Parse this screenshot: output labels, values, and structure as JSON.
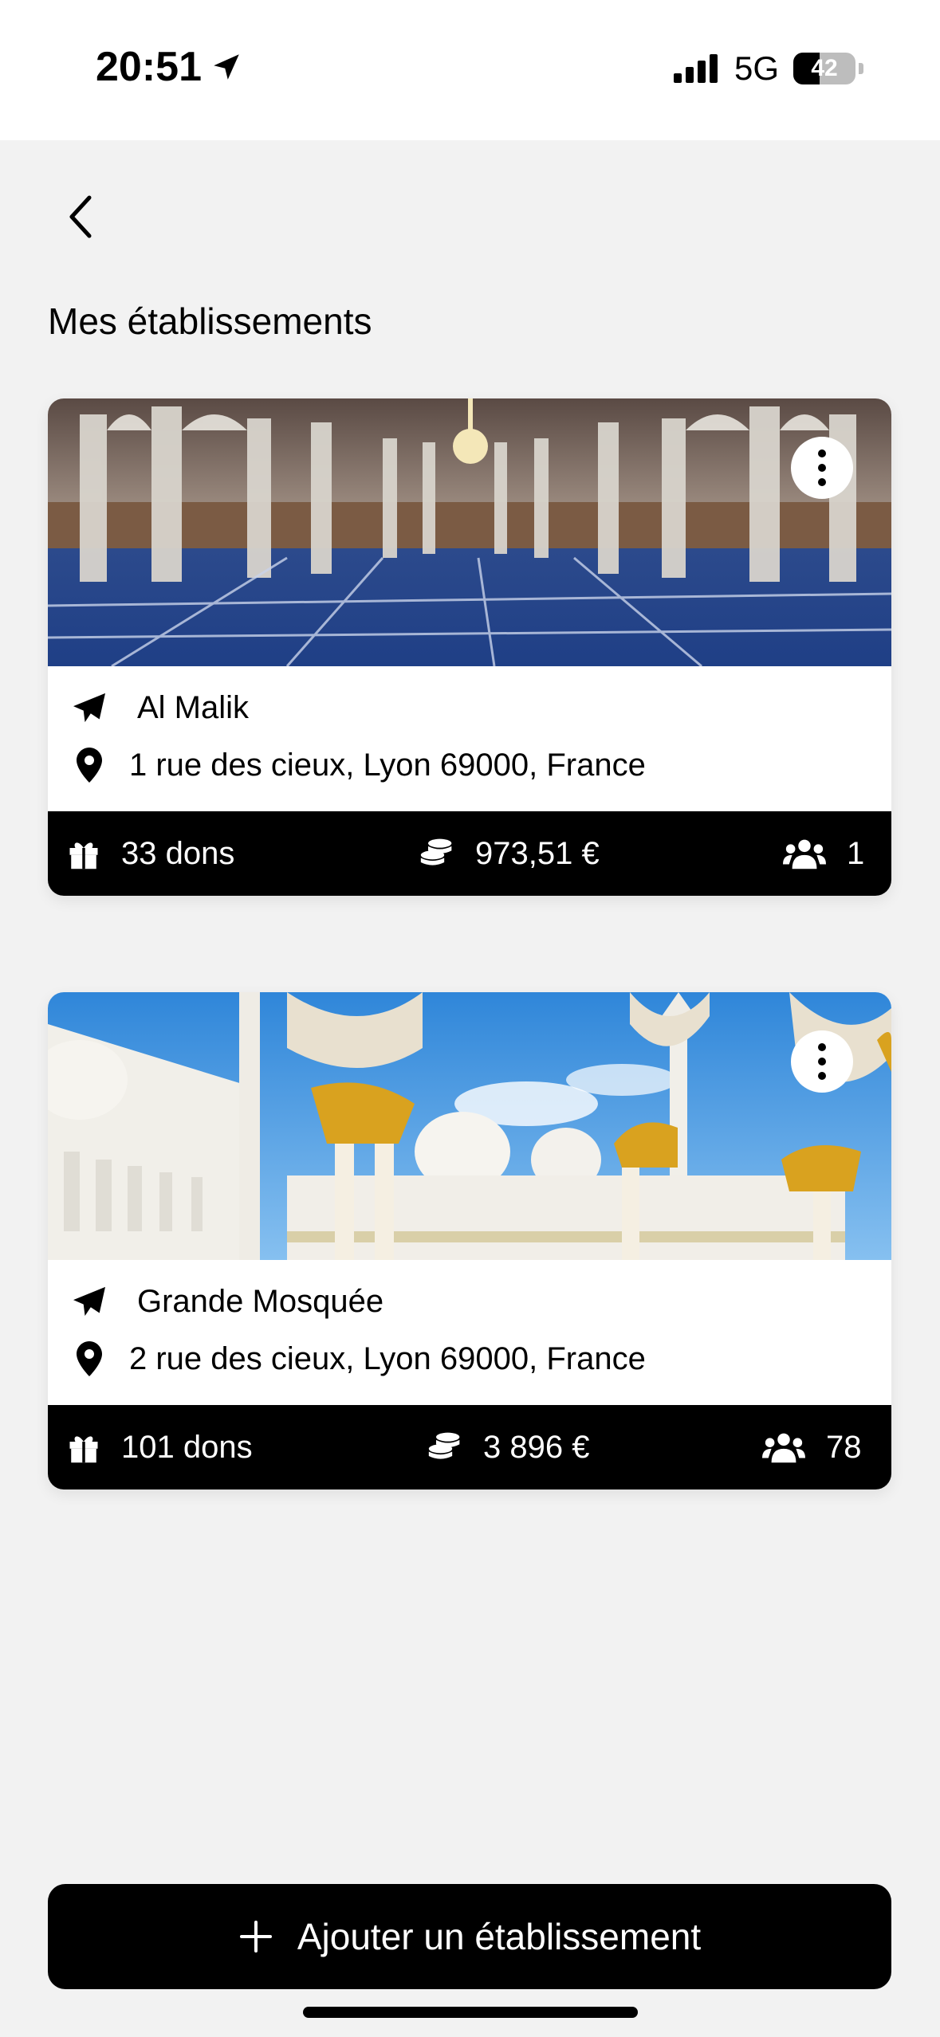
{
  "status_bar": {
    "time": "20:51",
    "network": "5G",
    "battery": "42",
    "battery_level": 0.42,
    "icons": [
      "location-arrow-icon",
      "signal-icon",
      "battery-icon"
    ]
  },
  "header": {
    "back_icon": "chevron-left-icon",
    "title": "Mes établissements"
  },
  "establishments": [
    {
      "name": "Al Malik",
      "address": "1 rue des cieux, Lyon 69000, France",
      "donations": "33 dons",
      "amount": "973,51 €",
      "members": "1",
      "image": "mosque-interior-photo"
    },
    {
      "name": "Grande Mosquée",
      "address": "2 rue des cieux, Lyon 69000, France",
      "donations": "101 dons",
      "amount": "3 896 €",
      "members": "78",
      "image": "mosque-exterior-photo"
    }
  ],
  "actions": {
    "add_label": "Ajouter un établissement",
    "add_icon": "plus-icon"
  },
  "colors": {
    "background": "#f2f2f2",
    "card": "#ffffff",
    "stats_bar": "#000000",
    "button": "#000000"
  }
}
